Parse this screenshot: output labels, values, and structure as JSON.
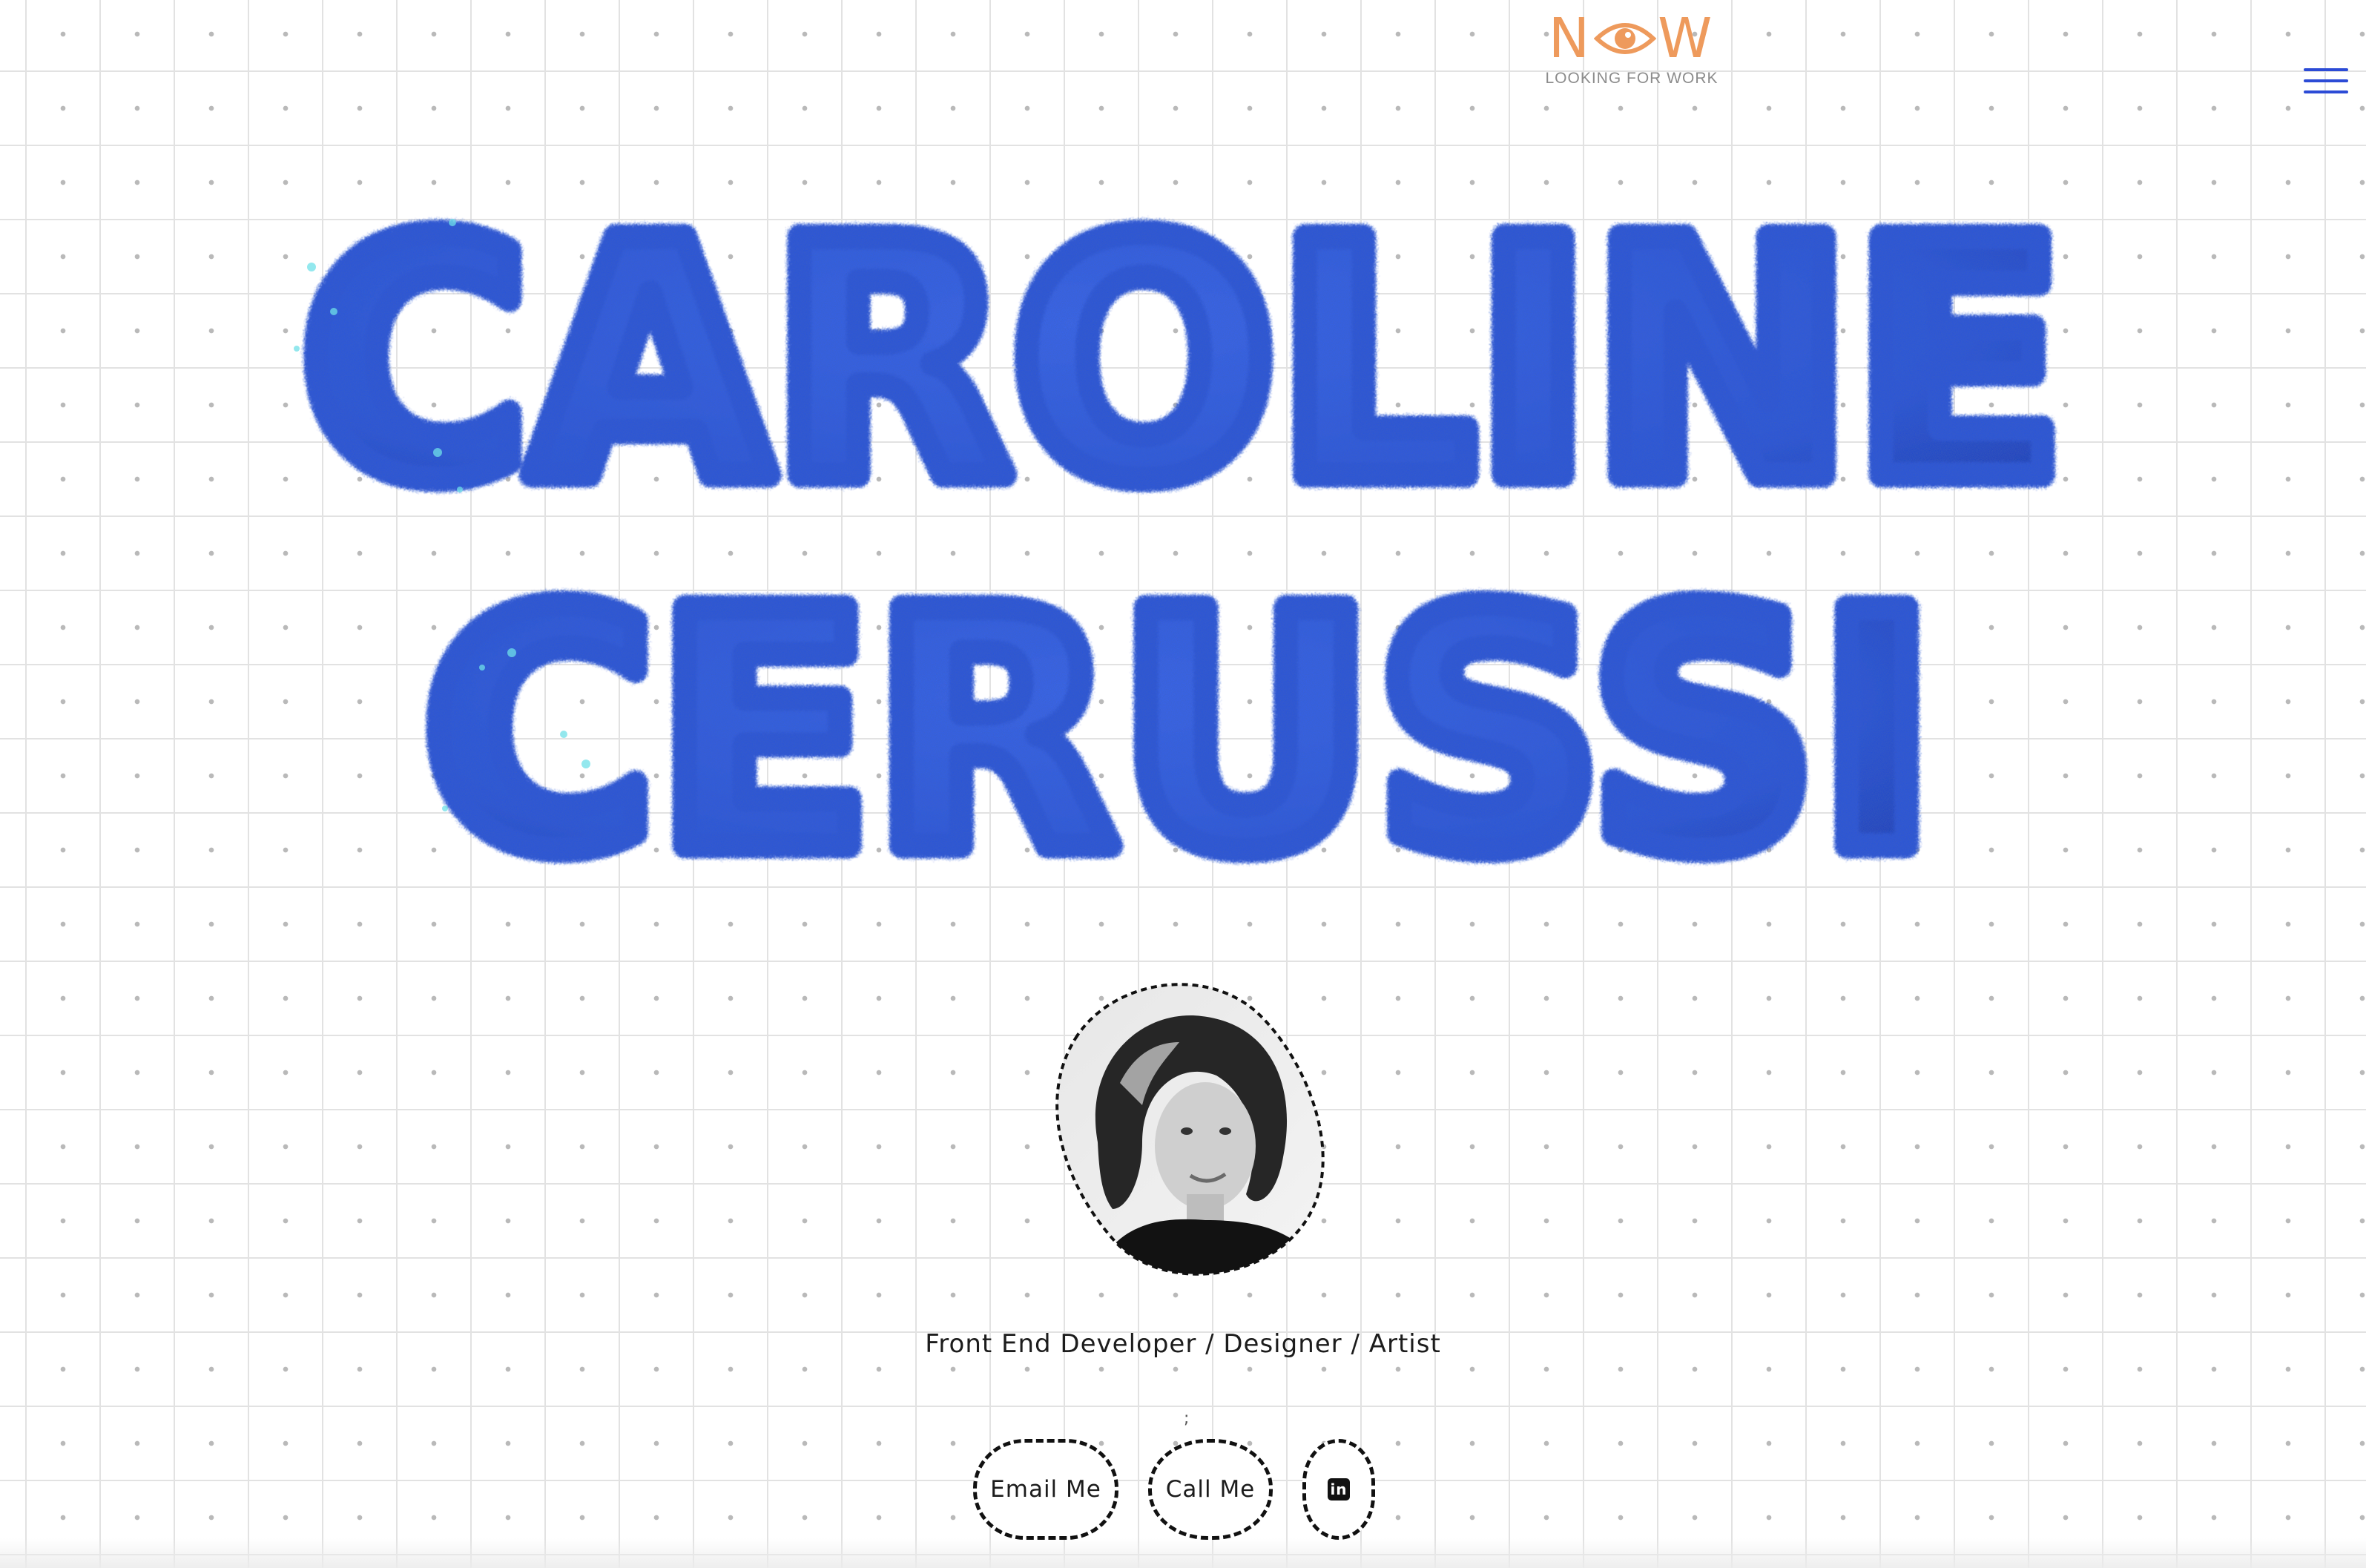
{
  "header": {
    "now_word_left": "N",
    "now_word_right": "W",
    "status_label": "LOOKING FOR WORK",
    "eye_icon": "eye-icon",
    "menu_icon": "hamburger-menu-icon"
  },
  "hero": {
    "name_line_1": "CAROLINE",
    "name_line_2": "CERUSSI",
    "fluff_color": "#2a55dc",
    "fluff_shadow_color": "#1a38b4",
    "highlight_color": "#6fe0e8"
  },
  "profile": {
    "avatar": "profile-photo",
    "tagline": "Front End Developer / Designer / Artist",
    "separator_mark": ";"
  },
  "actions": {
    "email_label": "Email Me",
    "call_label": "Call Me",
    "linkedin_icon": "linkedin-icon",
    "linkedin_glyph": "in"
  },
  "colors": {
    "accent": "#2c4bd6",
    "now_orange": "#ee9a5c",
    "grid_line": "#e2e2e2",
    "grid_dot": "#b9b9b9"
  }
}
